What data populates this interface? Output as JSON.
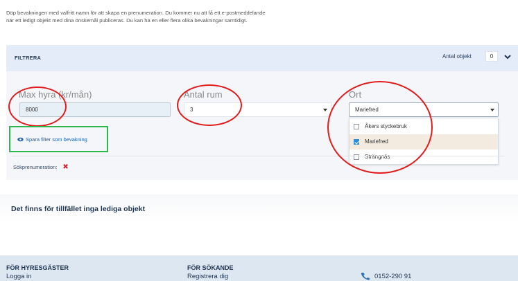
{
  "intro": {
    "line1": "Döp bevakningen med valfritt namn för att skapa en prenumeration. Du kommer nu att få ett e-postmeddelande",
    "line2": "när ett ledigt objekt med dina önskemål publiceras. Du kan ha en eller flera olika bevakningar samtidigt."
  },
  "filter": {
    "title": "FILTRERA",
    "count_label": "Antal objekt",
    "count_value": "0",
    "max_rent": {
      "label": "Max hyra (kr/mån)",
      "value": "8000"
    },
    "rooms": {
      "label": "Antal rum",
      "value": "3"
    },
    "location": {
      "label": "Ort",
      "value": "Mariefred",
      "options": [
        {
          "label": "Åkers styckebruk",
          "checked": false
        },
        {
          "label": "Mariefred",
          "checked": true
        },
        {
          "label": "Strängnäs",
          "checked": false
        }
      ]
    },
    "save_label": "Spara filter som bevakning",
    "subscription_label": "Sökprenumeration:"
  },
  "results": {
    "empty_text": "Det finns för tillfället inga lediga objekt"
  },
  "footer": {
    "tenants_heading": "FÖR HYRESGÄSTER",
    "tenants_link": "Logga in",
    "seekers_heading": "FÖR SÖKANDE",
    "seekers_link": "Registrera dig",
    "phone": "0152-290 91"
  },
  "annotations": {
    "circle_color": "#e21b1b",
    "box_color": "#2db84b"
  },
  "icons": [
    "chevron-down-icon",
    "eye-icon",
    "close-icon",
    "phone-icon",
    "dropdown-arrow-icon",
    "checkbox-icon"
  ]
}
